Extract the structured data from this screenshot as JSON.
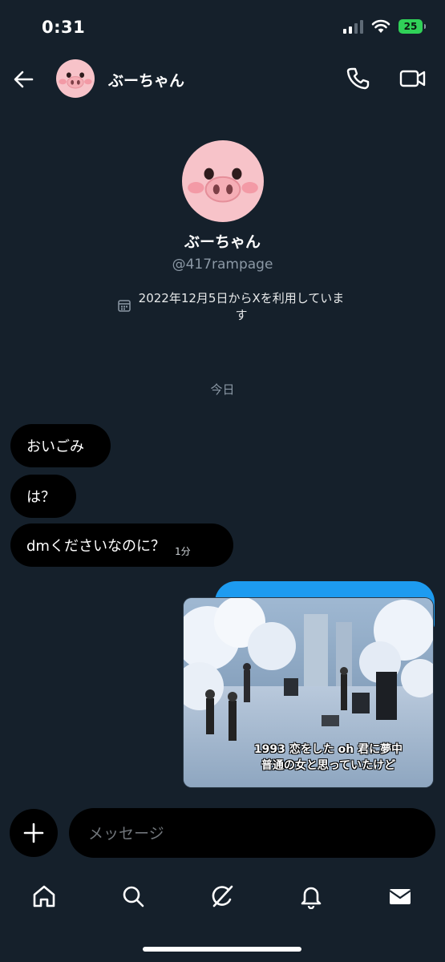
{
  "status_bar": {
    "time": "0:31",
    "battery": "25"
  },
  "header": {
    "name": "ぶーちゃん",
    "back_icon": "arrow-left-icon",
    "call_icon": "phone-icon",
    "video_icon": "video-camera-icon"
  },
  "profile": {
    "name": "ぶーちゃん",
    "handle": "@417rampage",
    "joined": "2022年12月5日からXを利用しています",
    "joined_icon": "calendar-icon"
  },
  "conversation": {
    "date_divider": "今日",
    "received": [
      {
        "text": "おいごみ"
      },
      {
        "text": "は？"
      },
      {
        "text": "dmくださいなのに？",
        "time": "1分"
      }
    ],
    "sent_media": {
      "caption_line1": "1993  恋をした  oh  君に夢中",
      "caption_line2": "普通の女と思っていたけど"
    }
  },
  "composer": {
    "placeholder": "メッセージ",
    "add_icon": "plus-icon"
  },
  "bottom_nav": {
    "items": [
      "home-icon",
      "search-icon",
      "grok-icon",
      "notifications-bell-icon",
      "messages-envelope-icon"
    ]
  },
  "colors": {
    "background": "#15202b",
    "bubble_received": "#000000",
    "bubble_sent": "#1d9bf0",
    "secondary_text": "#8b98a5",
    "battery": "#30d158"
  }
}
